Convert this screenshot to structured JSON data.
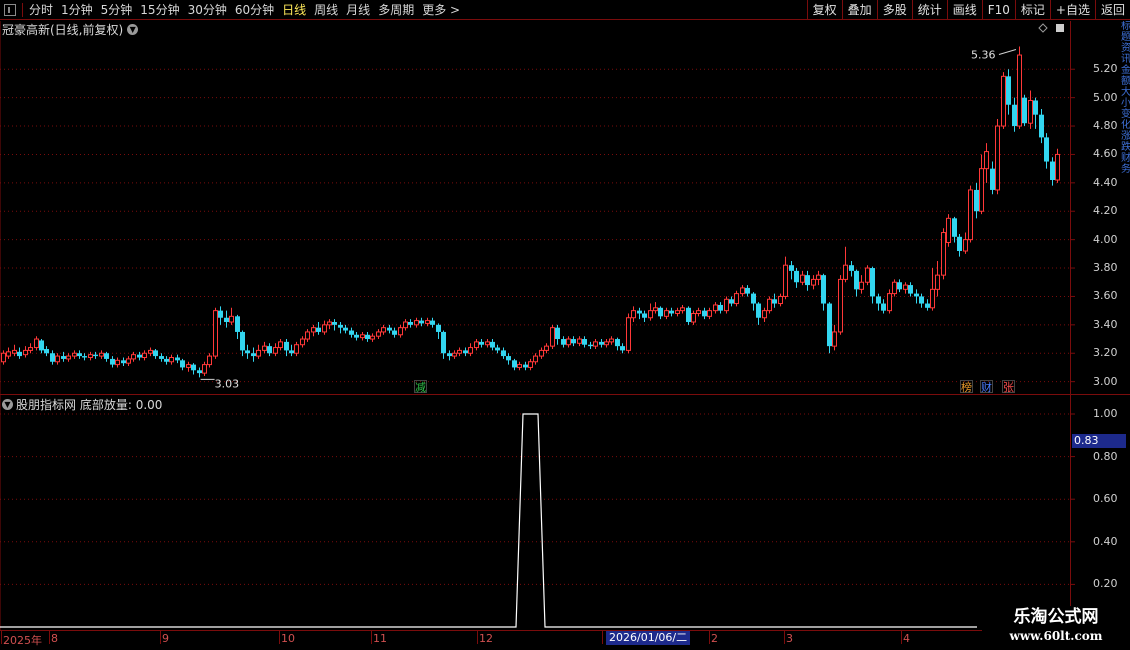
{
  "toolbar": {
    "periods": [
      "分时",
      "1分钟",
      "5分钟",
      "15分钟",
      "30分钟",
      "60分钟",
      "日线",
      "周线",
      "月线",
      "多周期",
      "更多"
    ],
    "active_period": "日线",
    "right_buttons": [
      "复权",
      "叠加",
      "多股",
      "统计",
      "画线",
      "F10",
      "标记",
      "+自选",
      "返回"
    ]
  },
  "main_panel": {
    "title": "冠豪高新(日线,前复权)",
    "y_labels": [
      "5.20",
      "5.00",
      "4.80",
      "4.60",
      "4.40",
      "4.20",
      "4.00",
      "3.80",
      "3.60",
      "3.40",
      "3.20",
      "3.00"
    ],
    "high_label": "5.36",
    "low_label": "3.03",
    "markers": [
      {
        "text": "减",
        "color": "#2fc24a"
      },
      {
        "text": "榜",
        "color": "#e89a2a"
      },
      {
        "text": "财",
        "color": "#4a7dff"
      },
      {
        "text": "张",
        "color": "#ff5050"
      }
    ]
  },
  "sub_panel": {
    "title": "股朋指标网",
    "indicator_name": "底部放量",
    "indicator_value": "0.00",
    "y_labels": [
      "1.00",
      "0.80",
      "0.60",
      "0.40",
      "0.20"
    ],
    "current_value": "0.83"
  },
  "x_axis": {
    "labels": [
      "2025年",
      "8",
      "9",
      "10",
      "11",
      "12",
      "1",
      "2",
      "3",
      "4"
    ],
    "current_date": "2026/01/06/二"
  },
  "watermark": {
    "line1": "乐淘公式网",
    "line2": "www.60lt.com"
  },
  "right_strip_text": "标题资讯金额大小变化涨跌财务",
  "colors": {
    "up": "#ff3838",
    "down": "#33d6f0",
    "grid": "#7a0c0c",
    "indicator": "#ffffff"
  },
  "chart_data": {
    "type": "candlestick",
    "ylim": [
      2.92,
      5.42
    ],
    "candles": [
      [
        3.14,
        3.2,
        3.22,
        3.12
      ],
      [
        3.18,
        3.21,
        3.24,
        3.16
      ],
      [
        3.2,
        3.22,
        3.26,
        3.18
      ],
      [
        3.21,
        3.18,
        3.24,
        3.16
      ],
      [
        3.19,
        3.22,
        3.25,
        3.17
      ],
      [
        3.22,
        3.24,
        3.27,
        3.2
      ],
      [
        3.24,
        3.3,
        3.32,
        3.22
      ],
      [
        3.29,
        3.22,
        3.3,
        3.2
      ],
      [
        3.23,
        3.2,
        3.25,
        3.18
      ],
      [
        3.2,
        3.14,
        3.22,
        3.12
      ],
      [
        3.14,
        3.18,
        3.2,
        3.12
      ],
      [
        3.18,
        3.16,
        3.21,
        3.14
      ],
      [
        3.16,
        3.18,
        3.2,
        3.14
      ],
      [
        3.18,
        3.2,
        3.22,
        3.16
      ],
      [
        3.2,
        3.18,
        3.22,
        3.16
      ],
      [
        3.18,
        3.17,
        3.2,
        3.15
      ],
      [
        3.17,
        3.19,
        3.21,
        3.15
      ],
      [
        3.19,
        3.18,
        3.21,
        3.16
      ],
      [
        3.18,
        3.2,
        3.22,
        3.16
      ],
      [
        3.2,
        3.16,
        3.21,
        3.14
      ],
      [
        3.16,
        3.12,
        3.18,
        3.1
      ],
      [
        3.12,
        3.15,
        3.17,
        3.1
      ],
      [
        3.15,
        3.13,
        3.17,
        3.11
      ],
      [
        3.13,
        3.16,
        3.18,
        3.11
      ],
      [
        3.16,
        3.19,
        3.21,
        3.14
      ],
      [
        3.19,
        3.17,
        3.21,
        3.15
      ],
      [
        3.17,
        3.2,
        3.22,
        3.15
      ],
      [
        3.2,
        3.22,
        3.24,
        3.18
      ],
      [
        3.22,
        3.18,
        3.23,
        3.16
      ],
      [
        3.18,
        3.16,
        3.2,
        3.14
      ],
      [
        3.16,
        3.14,
        3.18,
        3.12
      ],
      [
        3.14,
        3.17,
        3.19,
        3.12
      ],
      [
        3.17,
        3.15,
        3.19,
        3.13
      ],
      [
        3.15,
        3.1,
        3.16,
        3.08
      ],
      [
        3.1,
        3.12,
        3.14,
        3.07
      ],
      [
        3.12,
        3.08,
        3.13,
        3.05
      ],
      [
        3.08,
        3.06,
        3.1,
        3.03
      ],
      [
        3.06,
        3.12,
        3.14,
        3.04
      ],
      [
        3.12,
        3.18,
        3.2,
        3.1
      ],
      [
        3.18,
        3.5,
        3.52,
        3.16
      ],
      [
        3.5,
        3.45,
        3.53,
        3.4
      ],
      [
        3.45,
        3.42,
        3.5,
        3.38
      ],
      [
        3.42,
        3.46,
        3.52,
        3.4
      ],
      [
        3.46,
        3.35,
        3.47,
        3.3
      ],
      [
        3.35,
        3.22,
        3.36,
        3.18
      ],
      [
        3.22,
        3.2,
        3.26,
        3.16
      ],
      [
        3.2,
        3.18,
        3.24,
        3.14
      ],
      [
        3.18,
        3.22,
        3.26,
        3.16
      ],
      [
        3.22,
        3.25,
        3.28,
        3.2
      ],
      [
        3.25,
        3.2,
        3.27,
        3.18
      ],
      [
        3.2,
        3.24,
        3.27,
        3.18
      ],
      [
        3.24,
        3.28,
        3.3,
        3.22
      ],
      [
        3.28,
        3.22,
        3.3,
        3.18
      ],
      [
        3.22,
        3.2,
        3.26,
        3.18
      ],
      [
        3.2,
        3.26,
        3.28,
        3.18
      ],
      [
        3.26,
        3.3,
        3.32,
        3.24
      ],
      [
        3.3,
        3.35,
        3.37,
        3.28
      ],
      [
        3.35,
        3.38,
        3.4,
        3.32
      ],
      [
        3.38,
        3.35,
        3.42,
        3.33
      ],
      [
        3.35,
        3.4,
        3.43,
        3.33
      ],
      [
        3.4,
        3.42,
        3.44,
        3.37
      ],
      [
        3.42,
        3.4,
        3.44,
        3.36
      ],
      [
        3.4,
        3.38,
        3.42,
        3.34
      ],
      [
        3.38,
        3.36,
        3.4,
        3.34
      ],
      [
        3.36,
        3.33,
        3.38,
        3.31
      ],
      [
        3.33,
        3.31,
        3.35,
        3.29
      ],
      [
        3.31,
        3.33,
        3.35,
        3.29
      ],
      [
        3.33,
        3.3,
        3.35,
        3.28
      ],
      [
        3.3,
        3.32,
        3.34,
        3.28
      ],
      [
        3.32,
        3.35,
        3.37,
        3.3
      ],
      [
        3.35,
        3.38,
        3.4,
        3.33
      ],
      [
        3.38,
        3.36,
        3.4,
        3.34
      ],
      [
        3.36,
        3.33,
        3.38,
        3.31
      ],
      [
        3.33,
        3.38,
        3.4,
        3.31
      ],
      [
        3.38,
        3.42,
        3.44,
        3.36
      ],
      [
        3.42,
        3.4,
        3.44,
        3.38
      ],
      [
        3.4,
        3.43,
        3.45,
        3.38
      ],
      [
        3.43,
        3.41,
        3.45,
        3.39
      ],
      [
        3.41,
        3.43,
        3.45,
        3.39
      ],
      [
        3.43,
        3.4,
        3.45,
        3.38
      ],
      [
        3.4,
        3.35,
        3.41,
        3.3
      ],
      [
        3.35,
        3.2,
        3.36,
        3.16
      ],
      [
        3.2,
        3.18,
        3.22,
        3.15
      ],
      [
        3.18,
        3.2,
        3.22,
        3.16
      ],
      [
        3.2,
        3.22,
        3.24,
        3.18
      ],
      [
        3.22,
        3.2,
        3.24,
        3.18
      ],
      [
        3.2,
        3.24,
        3.27,
        3.18
      ],
      [
        3.24,
        3.28,
        3.3,
        3.22
      ],
      [
        3.28,
        3.26,
        3.3,
        3.24
      ],
      [
        3.26,
        3.28,
        3.3,
        3.24
      ],
      [
        3.28,
        3.24,
        3.3,
        3.22
      ],
      [
        3.24,
        3.22,
        3.26,
        3.2
      ],
      [
        3.22,
        3.18,
        3.24,
        3.16
      ],
      [
        3.18,
        3.15,
        3.2,
        3.12
      ],
      [
        3.15,
        3.1,
        3.16,
        3.08
      ],
      [
        3.1,
        3.12,
        3.14,
        3.08
      ],
      [
        3.12,
        3.1,
        3.14,
        3.08
      ],
      [
        3.1,
        3.14,
        3.16,
        3.08
      ],
      [
        3.14,
        3.18,
        3.2,
        3.12
      ],
      [
        3.18,
        3.22,
        3.24,
        3.16
      ],
      [
        3.22,
        3.25,
        3.27,
        3.2
      ],
      [
        3.25,
        3.38,
        3.4,
        3.23
      ],
      [
        3.38,
        3.3,
        3.4,
        3.26
      ],
      [
        3.3,
        3.26,
        3.32,
        3.24
      ],
      [
        3.26,
        3.3,
        3.32,
        3.24
      ],
      [
        3.3,
        3.27,
        3.32,
        3.25
      ],
      [
        3.27,
        3.3,
        3.32,
        3.25
      ],
      [
        3.3,
        3.26,
        3.32,
        3.24
      ],
      [
        3.26,
        3.25,
        3.28,
        3.23
      ],
      [
        3.25,
        3.28,
        3.3,
        3.23
      ],
      [
        3.28,
        3.26,
        3.3,
        3.24
      ],
      [
        3.26,
        3.28,
        3.3,
        3.24
      ],
      [
        3.28,
        3.3,
        3.32,
        3.26
      ],
      [
        3.3,
        3.25,
        3.31,
        3.22
      ],
      [
        3.25,
        3.22,
        3.27,
        3.2
      ],
      [
        3.22,
        3.45,
        3.48,
        3.2
      ],
      [
        3.45,
        3.5,
        3.53,
        3.42
      ],
      [
        3.5,
        3.48,
        3.52,
        3.44
      ],
      [
        3.48,
        3.45,
        3.5,
        3.42
      ],
      [
        3.45,
        3.5,
        3.55,
        3.43
      ],
      [
        3.5,
        3.52,
        3.56,
        3.48
      ],
      [
        3.52,
        3.46,
        3.53,
        3.44
      ],
      [
        3.46,
        3.5,
        3.52,
        3.44
      ],
      [
        3.5,
        3.48,
        3.52,
        3.46
      ],
      [
        3.48,
        3.5,
        3.52,
        3.46
      ],
      [
        3.5,
        3.52,
        3.54,
        3.48
      ],
      [
        3.52,
        3.42,
        3.53,
        3.4
      ],
      [
        3.42,
        3.48,
        3.5,
        3.4
      ],
      [
        3.48,
        3.5,
        3.52,
        3.46
      ],
      [
        3.5,
        3.46,
        3.52,
        3.44
      ],
      [
        3.46,
        3.5,
        3.52,
        3.44
      ],
      [
        3.5,
        3.54,
        3.56,
        3.48
      ],
      [
        3.54,
        3.5,
        3.56,
        3.48
      ],
      [
        3.5,
        3.58,
        3.6,
        3.48
      ],
      [
        3.58,
        3.55,
        3.6,
        3.53
      ],
      [
        3.55,
        3.62,
        3.64,
        3.53
      ],
      [
        3.62,
        3.66,
        3.68,
        3.6
      ],
      [
        3.66,
        3.62,
        3.68,
        3.6
      ],
      [
        3.62,
        3.55,
        3.63,
        3.5
      ],
      [
        3.55,
        3.45,
        3.56,
        3.4
      ],
      [
        3.45,
        3.5,
        3.52,
        3.42
      ],
      [
        3.5,
        3.58,
        3.6,
        3.48
      ],
      [
        3.58,
        3.55,
        3.62,
        3.52
      ],
      [
        3.55,
        3.6,
        3.62,
        3.53
      ],
      [
        3.6,
        3.82,
        3.88,
        3.58
      ],
      [
        3.82,
        3.78,
        3.85,
        3.72
      ],
      [
        3.78,
        3.7,
        3.8,
        3.66
      ],
      [
        3.7,
        3.75,
        3.78,
        3.68
      ],
      [
        3.75,
        3.68,
        3.78,
        3.64
      ],
      [
        3.68,
        3.72,
        3.75,
        3.65
      ],
      [
        3.72,
        3.75,
        3.78,
        3.68
      ],
      [
        3.75,
        3.55,
        3.76,
        3.5
      ],
      [
        3.55,
        3.25,
        3.56,
        3.2
      ],
      [
        3.25,
        3.35,
        3.4,
        3.22
      ],
      [
        3.35,
        3.72,
        3.75,
        3.33
      ],
      [
        3.72,
        3.82,
        3.95,
        3.7
      ],
      [
        3.82,
        3.78,
        3.85,
        3.74
      ],
      [
        3.78,
        3.65,
        3.79,
        3.6
      ],
      [
        3.65,
        3.7,
        3.75,
        3.62
      ],
      [
        3.7,
        3.8,
        3.82,
        3.68
      ],
      [
        3.8,
        3.6,
        3.81,
        3.55
      ],
      [
        3.6,
        3.55,
        3.62,
        3.5
      ],
      [
        3.55,
        3.5,
        3.58,
        3.48
      ],
      [
        3.5,
        3.62,
        3.65,
        3.48
      ],
      [
        3.62,
        3.7,
        3.72,
        3.6
      ],
      [
        3.7,
        3.65,
        3.72,
        3.63
      ],
      [
        3.65,
        3.68,
        3.7,
        3.62
      ],
      [
        3.68,
        3.62,
        3.7,
        3.6
      ],
      [
        3.62,
        3.6,
        3.65,
        3.55
      ],
      [
        3.6,
        3.55,
        3.62,
        3.52
      ],
      [
        3.55,
        3.52,
        3.58,
        3.5
      ],
      [
        3.52,
        3.65,
        3.8,
        3.5
      ],
      [
        3.65,
        3.75,
        3.85,
        3.6
      ],
      [
        3.75,
        4.05,
        4.08,
        3.72
      ],
      [
        3.98,
        4.15,
        4.18,
        3.95
      ],
      [
        4.15,
        4.02,
        4.16,
        3.98
      ],
      [
        4.02,
        3.92,
        4.04,
        3.88
      ],
      [
        3.92,
        4.0,
        4.05,
        3.9
      ],
      [
        4.0,
        4.35,
        4.38,
        3.98
      ],
      [
        4.35,
        4.2,
        4.4,
        4.15
      ],
      [
        4.2,
        4.5,
        4.6,
        4.18
      ],
      [
        4.5,
        4.62,
        4.68,
        4.4
      ],
      [
        4.5,
        4.35,
        4.55,
        4.32
      ],
      [
        4.35,
        4.8,
        4.85,
        4.32
      ],
      [
        4.8,
        5.15,
        5.18,
        4.78
      ],
      [
        5.15,
        4.95,
        5.2,
        4.88
      ],
      [
        4.95,
        4.8,
        5.0,
        4.76
      ],
      [
        4.8,
        5.3,
        5.36,
        4.78
      ],
      [
        5.0,
        4.82,
        5.02,
        4.8
      ],
      [
        4.82,
        4.98,
        5.05,
        4.78
      ],
      [
        4.98,
        4.88,
        5.0,
        4.78
      ],
      [
        4.88,
        4.72,
        4.92,
        4.68
      ],
      [
        4.72,
        4.55,
        4.75,
        4.5
      ],
      [
        4.55,
        4.42,
        4.58,
        4.38
      ],
      [
        4.42,
        4.6,
        4.64,
        4.4
      ]
    ],
    "indicator": {
      "name": "底部放量",
      "ylim": [
        0,
        1.0
      ],
      "values_nonzero_range": "pulse of 1.00 around late December 2025 / early January 2026, 0.00 elsewhere"
    }
  }
}
